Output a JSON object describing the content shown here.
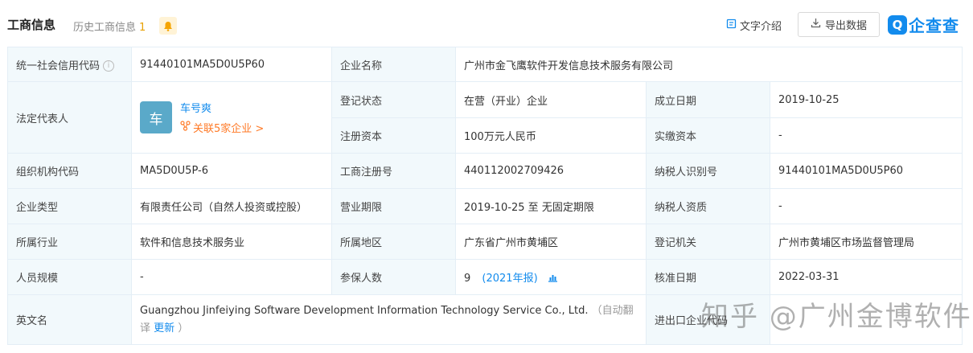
{
  "header": {
    "title": "工商信息",
    "history_label": "历史工商信息",
    "history_count": "1",
    "text_intro": "文字介绍",
    "export_label": "导出数据",
    "logo_text": "企查查",
    "logo_mark": "Q"
  },
  "rows": {
    "credit_code": {
      "label": "统一社会信用代码",
      "value": "91440101MA5D0U5P60"
    },
    "company_name": {
      "label": "企业名称",
      "value": "广州市金飞鹰软件开发信息技术服务有限公司"
    },
    "legal_rep": {
      "label": "法定代表人",
      "avatar": "车",
      "name": "车号爽",
      "related": "关联5家企业 >"
    },
    "reg_status": {
      "label": "登记状态",
      "value": "在营（开业）企业"
    },
    "founded": {
      "label": "成立日期",
      "value": "2019-10-25"
    },
    "reg_capital": {
      "label": "注册资本",
      "value": "100万元人民币"
    },
    "paid_capital": {
      "label": "实缴资本",
      "value": "-"
    },
    "org_code": {
      "label": "组织机构代码",
      "value": "MA5D0U5P-6"
    },
    "biz_reg_no": {
      "label": "工商注册号",
      "value": "440112002709426"
    },
    "taxpayer_id": {
      "label": "纳税人识别号",
      "value": "91440101MA5D0U5P60"
    },
    "company_type": {
      "label": "企业类型",
      "value": "有限责任公司（自然人投资或控股）"
    },
    "biz_term": {
      "label": "营业期限",
      "value": "2019-10-25 至 无固定期限"
    },
    "taxpayer_qual": {
      "label": "纳税人资质",
      "value": "-"
    },
    "industry": {
      "label": "所属行业",
      "value": "软件和信息技术服务业"
    },
    "region": {
      "label": "所属地区",
      "value": "广东省广州市黄埔区"
    },
    "reg_authority": {
      "label": "登记机关",
      "value": "广州市黄埔区市场监督管理局"
    },
    "staff_size": {
      "label": "人员规模",
      "value": "-"
    },
    "insured": {
      "label": "参保人数",
      "value": "9",
      "year": "(2021年报)"
    },
    "approval_date": {
      "label": "核准日期",
      "value": "2022-03-31"
    },
    "english_name": {
      "label": "英文名",
      "value": "Guangzhou Jinfeiying Software Development Information Technology Service Co., Ltd.",
      "note_prefix": "（自动翻译",
      "update": "更新",
      "note_suffix": "）"
    },
    "import_export": {
      "label": "进出口企业代码"
    }
  },
  "watermark": "知乎 @广州金博软件",
  "colors": {
    "accent": "#128bed",
    "orange": "#ff7a27",
    "label_bg": "#f2f9fc",
    "border": "#e4eef6"
  }
}
